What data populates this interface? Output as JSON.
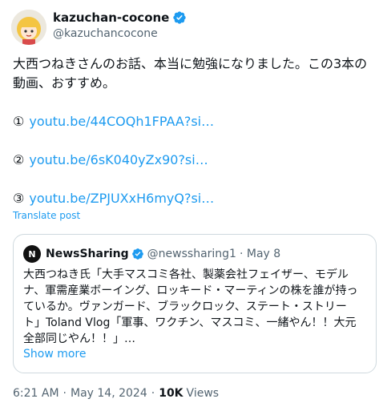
{
  "author": {
    "name": "kazuchan-cocone",
    "handle": "@kazuchancocone",
    "verified_color": "#1d9bf0"
  },
  "tweet": {
    "text": "大西つねきさんのお話、本当に勉強になりました。この3本の動画、おすすめ。",
    "links": [
      {
        "num": "①",
        "url": "youtu.be/44COQh1FPAA?si…"
      },
      {
        "num": "②",
        "url": "youtu.be/6sK040yZx90?si…"
      },
      {
        "num": "③",
        "url": "youtu.be/ZPJUXxH6myQ?si…"
      }
    ],
    "translate_label": "Translate post"
  },
  "quoted": {
    "avatar_letter": "N",
    "name": "NewsSharing",
    "handle": "@newssharing1",
    "date": "· May 8",
    "text": "大西つねき氏「大手マスコミ各社、製薬会社フェイザー、モデルナ、軍需産業ボーイング、ロッキード・マーティンの株を誰が持っているか。ヴァンガード、ブラックロック、ステート・ストリート」Toland Vlog「軍事、ワクチン、マスコミ、一緒やん！！大元全部同じやん！！」…",
    "show_more": "Show more"
  },
  "meta": {
    "time": "6:21 AM",
    "date": "May 14, 2024",
    "views_count": "10K",
    "views_label": "Views"
  }
}
